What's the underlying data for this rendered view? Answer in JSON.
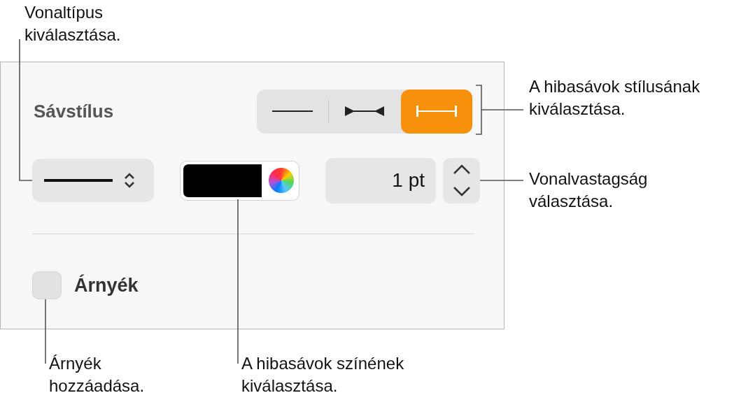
{
  "annotations": [
    {
      "text": "Vonaltípus\nkiválasztása."
    },
    {
      "text": "A hibasávok stílusának\nkiválasztása."
    },
    {
      "text": "Vonalvastagság\nválasztása."
    },
    {
      "text": "Árnyék\nhozzáadása."
    },
    {
      "text": "A hibasávok színének\nkiválasztása."
    }
  ],
  "panel": {
    "title": "Sávstílus",
    "segments": [
      {
        "kind": "plain",
        "selected": false
      },
      {
        "kind": "arrows",
        "selected": false
      },
      {
        "kind": "bars",
        "selected": true
      }
    ],
    "thickness": "1 pt",
    "shadow": {
      "label": "Árnyék",
      "checked": false
    }
  }
}
